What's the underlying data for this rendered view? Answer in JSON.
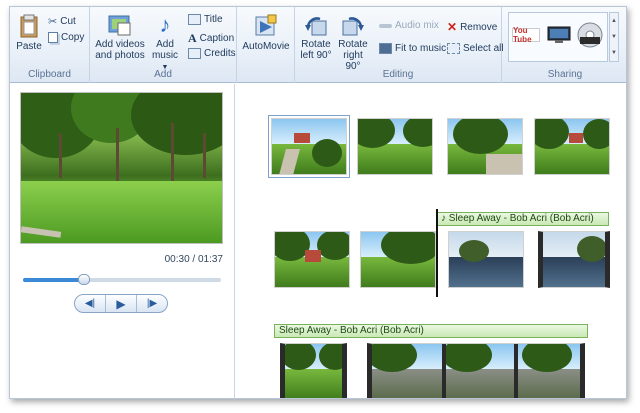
{
  "ribbon": {
    "clipboard": {
      "paste": "Paste",
      "cut": "Cut",
      "copy": "Copy",
      "label": "Clipboard"
    },
    "add": {
      "add_videos": "Add videos",
      "add_videos2": "and photos",
      "add_music": "Add",
      "add_music2": "music",
      "title": "Title",
      "caption": "Caption",
      "credits": "Credits",
      "label": "Add"
    },
    "automovie": {
      "label": "AutoMovie"
    },
    "editing": {
      "rotate_left": "Rotate",
      "rotate_left2": "left 90°",
      "rotate_right": "Rotate",
      "rotate_right2": "right 90°",
      "audio_mix": "Audio mix",
      "fit_to_music": "Fit to music",
      "remove": "Remove",
      "select_all": "Select all",
      "label": "Editing"
    },
    "sharing": {
      "youtube": "You Tube",
      "label": "Sharing"
    }
  },
  "preview": {
    "time": "00:30 / 01:37",
    "progress": 0.31
  },
  "storyboard": {
    "music_tracks": [
      "Sleep Away - Bob Acri (Bob Acri)",
      "Sleep Away - Bob Acri (Bob Acri)"
    ]
  }
}
